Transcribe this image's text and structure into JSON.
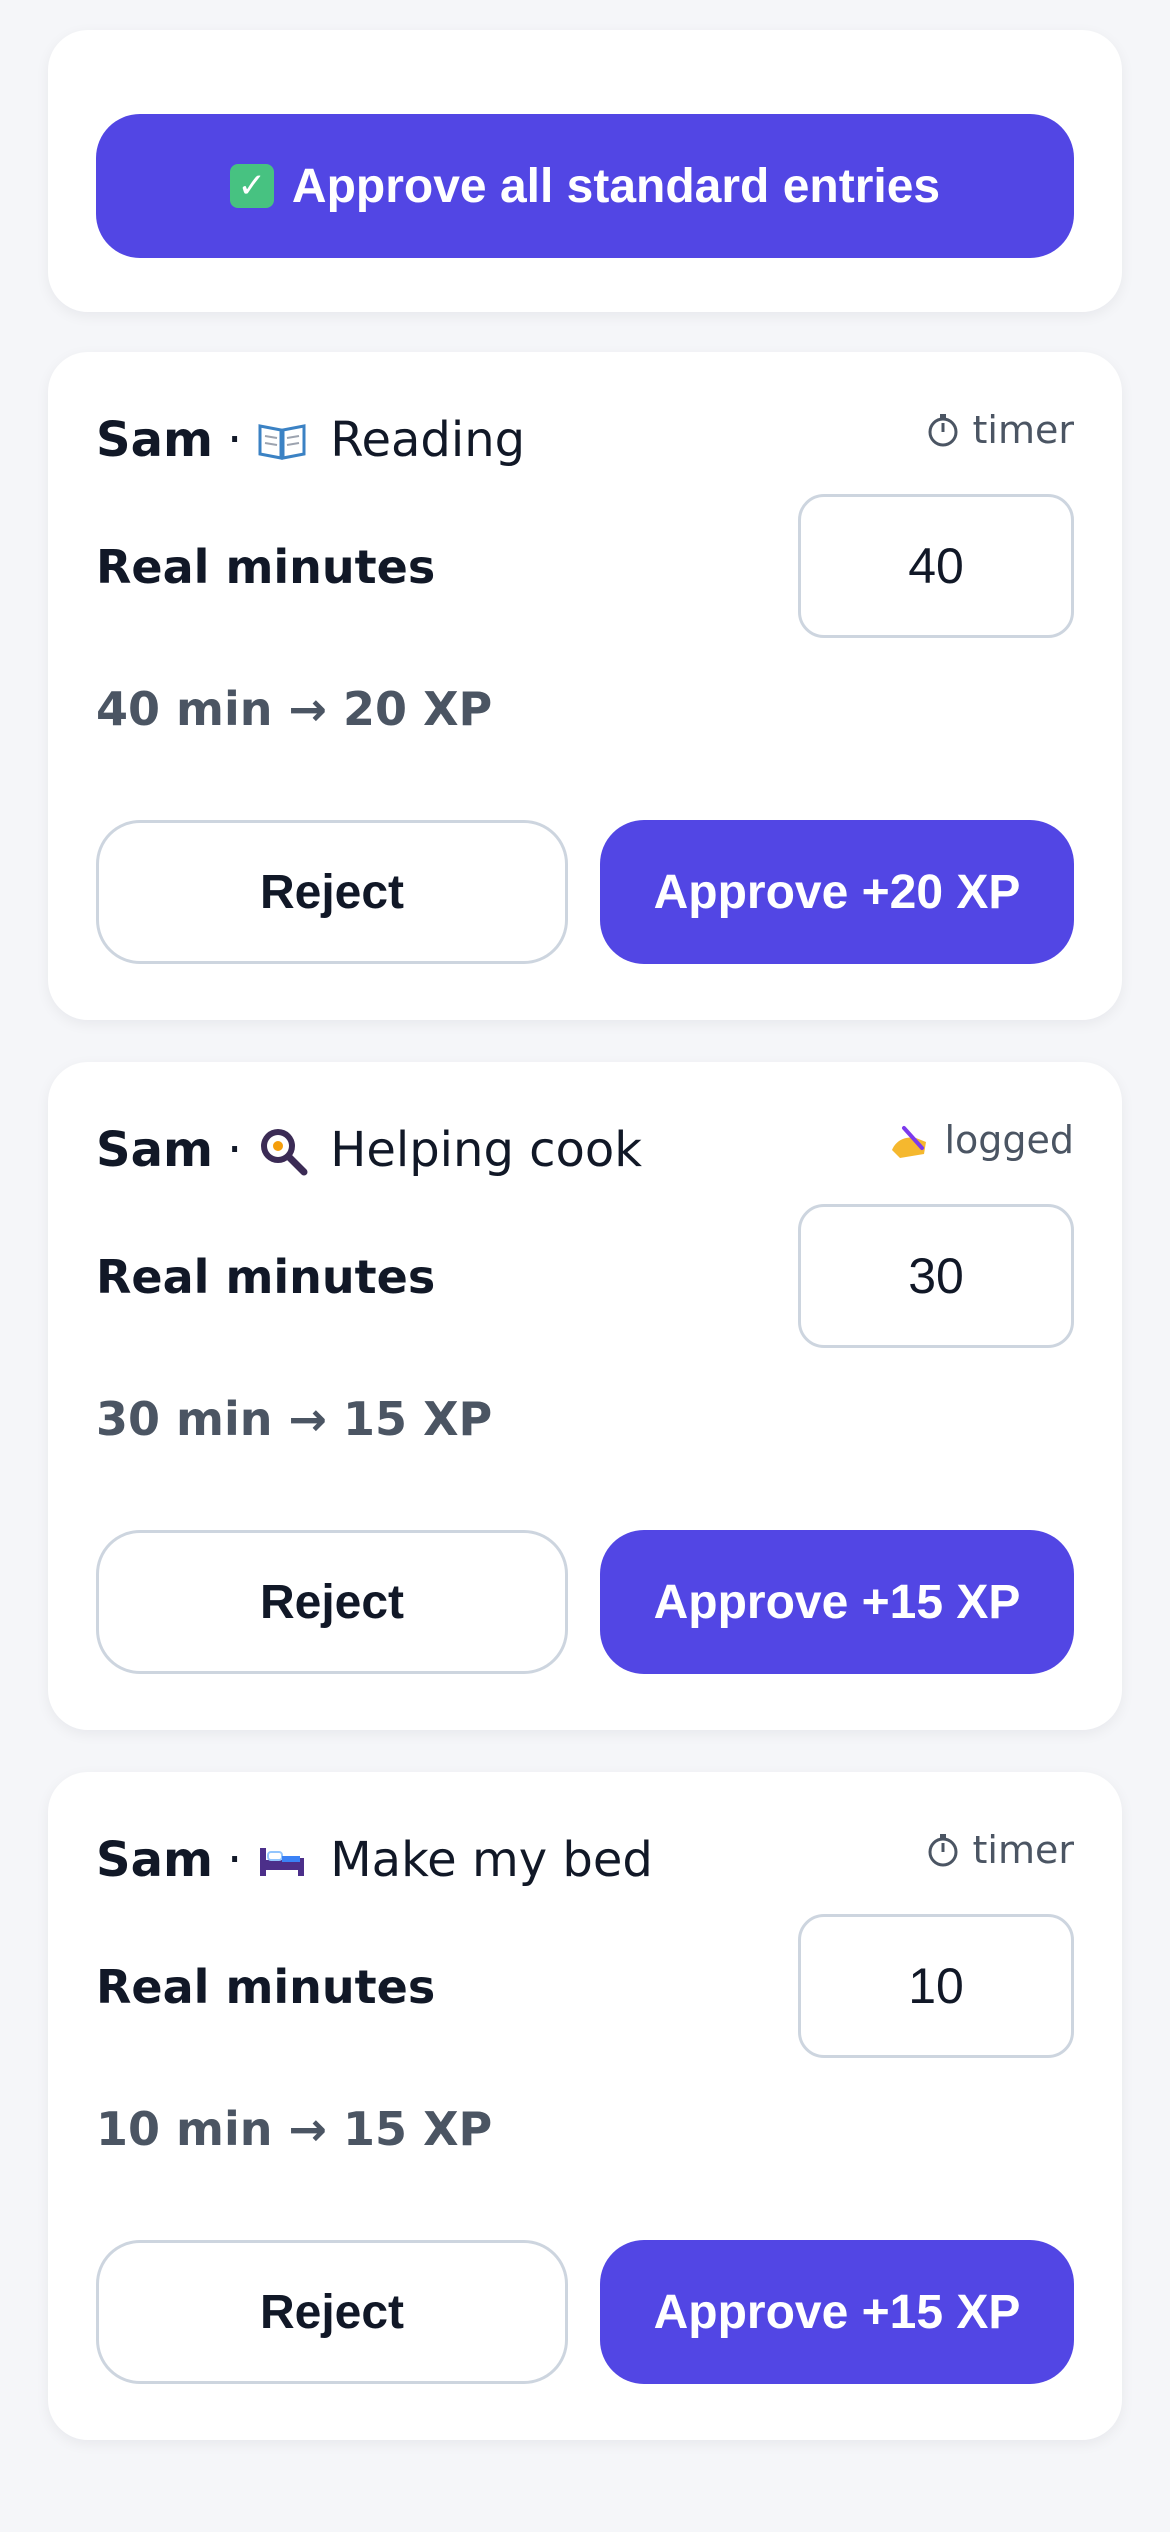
{
  "approve_all": {
    "label": "Approve all standard entries",
    "icon": "check-mark-button-icon"
  },
  "entries": [
    {
      "kid": "Sam",
      "separator": "·",
      "task_icon": "open-book-icon",
      "task": "Reading",
      "source_icon": "stopwatch-icon",
      "source": "timer",
      "minutes_label": "Real minutes",
      "minutes": "40",
      "summary": "40 min → 20 XP",
      "reject_label": "Reject",
      "approve_label": "Approve +20 XP"
    },
    {
      "kid": "Sam",
      "separator": "·",
      "task_icon": "frying-pan-icon",
      "task": "Helping cook",
      "source_icon": "writing-hand-icon",
      "source": "logged",
      "minutes_label": "Real minutes",
      "minutes": "30",
      "summary": "30 min → 15 XP",
      "reject_label": "Reject",
      "approve_label": "Approve +15 XP"
    },
    {
      "kid": "Sam",
      "separator": "·",
      "task_icon": "bed-icon",
      "task": "Make my bed",
      "source_icon": "stopwatch-icon",
      "source": "timer",
      "minutes_label": "Real minutes",
      "minutes": "10",
      "summary": "10 min → 15 XP",
      "reject_label": "Reject",
      "approve_label": "Approve +15 XP"
    }
  ],
  "colors": {
    "primary": "#5246e4",
    "background": "#f5f6f9",
    "card": "#ffffff",
    "border": "#cdd5df",
    "muted_text": "#4b5563",
    "check_green": "#47c281"
  }
}
